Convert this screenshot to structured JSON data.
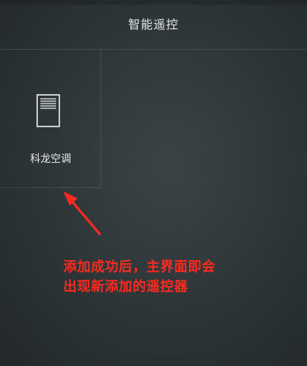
{
  "header": {
    "title": "智能遥控"
  },
  "devices": [
    {
      "label": "科龙空调",
      "icon": "air-conditioner-icon"
    }
  ],
  "annotation": {
    "line1": "添加成功后，主界面即会",
    "line2": "出现新添加的遥控器",
    "color": "#ff2a1f"
  }
}
